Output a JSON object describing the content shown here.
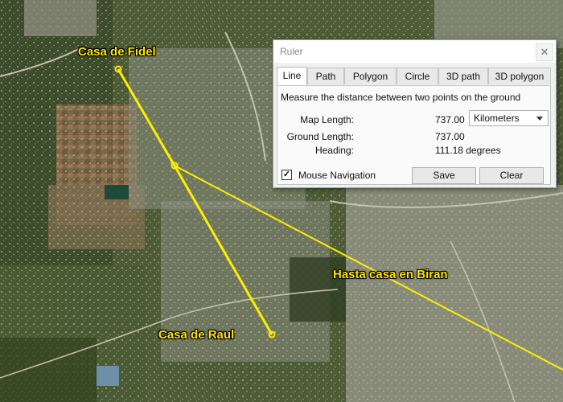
{
  "map": {
    "labels": {
      "fidel": "Casa de Fidel",
      "raul": "Casa de Raul",
      "biran": "Hasta casa en Biran"
    },
    "colors": {
      "line": "#ffee00",
      "label": "#ffe600"
    }
  },
  "ruler": {
    "title": "Ruler",
    "close_icon": "close-icon",
    "tabs": [
      {
        "label": "Line",
        "active": true
      },
      {
        "label": "Path"
      },
      {
        "label": "Polygon"
      },
      {
        "label": "Circle"
      },
      {
        "label": "3D path"
      },
      {
        "label": "3D polygon"
      }
    ],
    "description": "Measure the distance between two points on the ground",
    "map_length_label": "Map Length:",
    "map_length_value": "737.00",
    "unit_selected": "Kilometers",
    "ground_length_label": "Ground Length:",
    "ground_length_value": "737.00",
    "heading_label": "Heading:",
    "heading_value": "111.18 degrees",
    "mouse_navigation_label": "Mouse Navigation",
    "mouse_navigation_checked": true,
    "check_mark": "✓",
    "save_label": "Save",
    "clear_label": "Clear"
  }
}
